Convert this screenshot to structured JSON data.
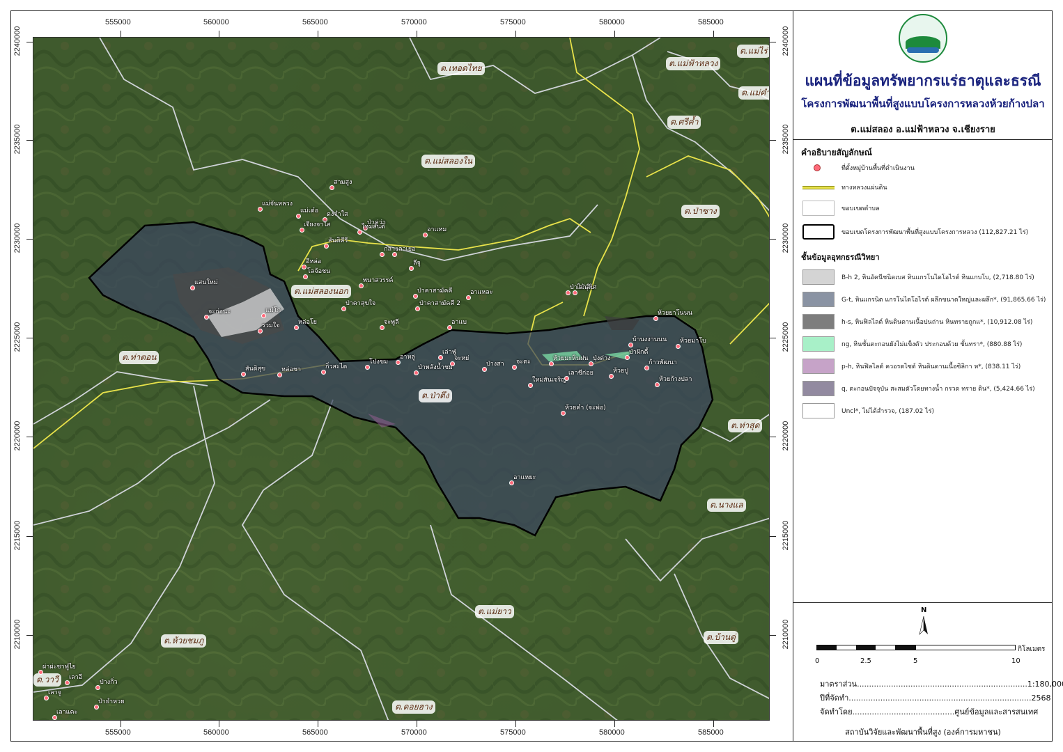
{
  "title": {
    "main": "แผนที่ข้อมูลทรัพยากรแร่ธาตุและธรณี",
    "project": "โครงการพัฒนาพื้นที่สูงแบบโครงการหลวงห้วยก้างปลา",
    "location": "ต.แม่สลอง อ.แม่ฟ้าหลวง จ.เชียงราย"
  },
  "axes": {
    "x_ticks": [
      "555000",
      "560000",
      "565000",
      "570000",
      "575000",
      "580000",
      "585000"
    ],
    "y_ticks": [
      "2240000",
      "2235000",
      "2230000",
      "2225000",
      "2220000",
      "2215000",
      "2210000"
    ]
  },
  "tambons": [
    {
      "name": "ต.เทอดไทย"
    },
    {
      "name": "ต.แม่ฟ้าหลวง"
    },
    {
      "name": "ต.แม่ไร่"
    },
    {
      "name": "ต.แม่คำ"
    },
    {
      "name": "ต.ศรีค้ำ"
    },
    {
      "name": "ต.แม่สลองใน"
    },
    {
      "name": "ต.ป่าซาง"
    },
    {
      "name": "ต.แม่สลองนอก"
    },
    {
      "name": "ต.ท่าตอน"
    },
    {
      "name": "ต.ป่าตึง"
    },
    {
      "name": "ต.ท่าสุด"
    },
    {
      "name": "ต.นางแล"
    },
    {
      "name": "ต.แม่ยาว"
    },
    {
      "name": "ต.ห้วยชมภู"
    },
    {
      "name": "ต.บ้านดู่"
    },
    {
      "name": "ต.ดอยฮาง"
    },
    {
      "name": "ต.วาวี"
    }
  ],
  "villages": [
    "สามสูง",
    "แม่จันหลวง",
    "แม่เต๋อ",
    "ดงจำใส",
    "ป่าคู่ว่า",
    "เจียงจาใส",
    "ใหม่สันติ",
    "อาแหม",
    "สันติคีรี",
    "อีหล่อ",
    "กลาง",
    "เลาเยอ",
    "ลีจู",
    "โลจ้อชน",
    "แสนใหม่",
    "พนาสวรรค์",
    "ป่าคาสามัคคี",
    "อาแหละ",
    "จะก่อนะ",
    "แม่โก",
    "ป่าคาสุขใจ",
    "ป่าคาสามัคคี 2",
    "ป่าไม้อุทิศ",
    "เลาสิบ",
    "รวมใจ",
    "หล่อโย",
    "จะพูลี",
    "อาแบ",
    "ห้วยยาโนนน",
    "สันติสุข",
    "หล่อชา",
    "กิ่วสะไต",
    "โป่งขม",
    "อาหลู่",
    "เล่าฟู่",
    "ป่าพลังน้ำชม",
    "จะหย่",
    "ป่างสา",
    "จะตะ",
    "ห้วยมะหินฝน",
    "ปุ่งต่าง",
    "บ้านงงานนน",
    "ป่าฝักดี้",
    "ห้วยมาโบ",
    "ใหม่สันเจริญ",
    "เลาชีก่อย",
    "ห้วยปู",
    "ก้าวพัฒนา",
    "ห้วยก้างปลา",
    "ห้วยคำ (จะพ่อ)",
    "อาแหยะ",
    "ผ่าผ่ะชาฟู่ไย",
    "เลาอี",
    "ป่างกิ่ว",
    "เลาจู",
    "ป่ายำหวย",
    "เลาแคะ"
  ],
  "legend": {
    "heading": "คำอธิบายสัญลักษณ์",
    "items": [
      {
        "label": "ที่ตั้งหมู่บ้านพื้นที่ดำเนินงาน"
      },
      {
        "label": "ทางหลวงแผ่นดิน"
      },
      {
        "label": "ขอบเขตตำบล"
      },
      {
        "label": "ขอบเขตโครงการพัฒนาพื้นที่สูงแบบโครงการหลวง (112,827.21 ไร่)"
      }
    ],
    "geo_heading": "ชั้นข้อมูลอุทกธรณีวิทยา",
    "geo_items": [
      {
        "label": "B-h 2, หินอัคนีชนิดเบส หินแกรโนไดโอไรต์ หินแกบโบ, (2,718.80 ไร่)",
        "color": "#d4d4d4"
      },
      {
        "label": "G-t, หินแกรนิต แกรโนไดโอไรต์ ผลึกขนาดใหญ่และผลึก*, (91,865.66 ไร่)",
        "color": "#8a93a3"
      },
      {
        "label": "h-s, หินฟิลไลต์ หินดินดานเนื้อปนถ่าน หินทรายถูกแ*, (10,912.08 ไร่)",
        "color": "#7d7d7d"
      },
      {
        "label": "ng, หินชั้นตะกอนยังไม่แข็งตัว ประกอบด้วย ชั้นทรา*, (880.88 ไร่)",
        "color": "#a8f0c8"
      },
      {
        "label": "p-h, หินฟิลไลต์ ควอรตไซต์ หินดินดานเนื้อซิลิกา ห*, (838.11 ไร่)",
        "color": "#c6a3c8"
      },
      {
        "label": "q, ตะกอนปัจจุบัน สะสมตัวโดยทางน้ำ กรวด ทราย ดิน*, (5,424.66 ไร่)",
        "color": "#928aa0"
      },
      {
        "label": "Uncl*, ไม่ได้สำรวจ, (187.02 ไร่)",
        "color": "#ffffff"
      }
    ]
  },
  "scale": {
    "ticks": [
      "0",
      "2.5",
      "5",
      "10"
    ],
    "unit": "กิโลเมตร",
    "north": "N"
  },
  "info": {
    "scale_label": "มาตราส่วน......................................................................1:180,000",
    "year_label": "ปีที่จัดทำ...........................................................................2568",
    "by_label": "จัดทำโดย..........................................ศูนย์ข้อมูลและสารสนเทศ",
    "org": "สถาบันวิจัยและพัฒนาพื้นที่สูง (องค์การมหาชน)"
  },
  "colors": {
    "highway": "#e8e24a",
    "boundary": "#cfd3d8",
    "project_boundary": "#000000",
    "village_pin": "#ff6a7a"
  }
}
